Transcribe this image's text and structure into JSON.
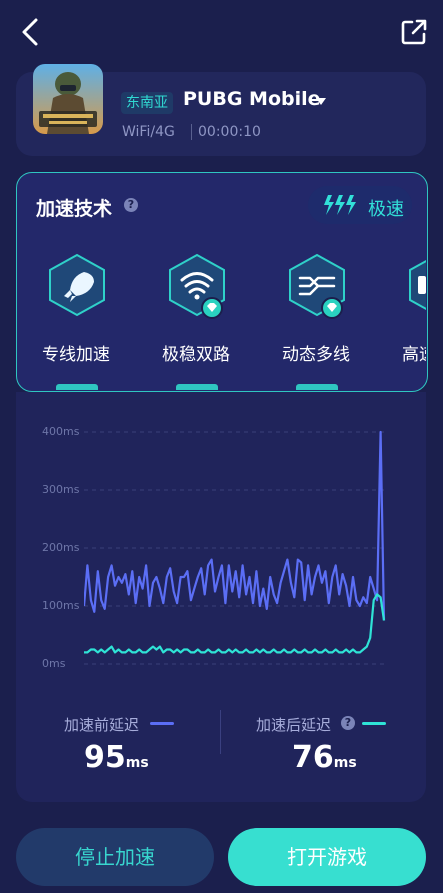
{
  "header": {
    "back_icon": "chevron-left-icon",
    "share_icon": "share-icon"
  },
  "game": {
    "icon": "pubg-game-icon",
    "region": "东南亚",
    "name": "PUBG Mobile",
    "network": "WiFi/4G",
    "timer": "00:00:10"
  },
  "tech": {
    "title": "加速技术",
    "help": "?",
    "mode_label": "极速",
    "features": [
      {
        "label": "专线加速",
        "icon": "rocket-icon",
        "premium": false
      },
      {
        "label": "极稳双路",
        "icon": "wifi-icon",
        "premium": true
      },
      {
        "label": "动态多线",
        "icon": "multiline-icon",
        "premium": true
      },
      {
        "label": "高速",
        "icon": "speed-icon",
        "premium": false
      }
    ]
  },
  "chart_data": {
    "type": "line",
    "yticks": [
      "400ms",
      "300ms",
      "200ms",
      "100ms",
      "0ms"
    ],
    "ylim": [
      0,
      400
    ],
    "grid": true,
    "series": [
      {
        "name": "加速前延迟",
        "color": "#5b6ef5",
        "values": [
          100,
          170,
          110,
          90,
          160,
          110,
          95,
          150,
          170,
          135,
          150,
          140,
          155,
          120,
          160,
          105,
          150,
          130,
          170,
          100,
          140,
          150,
          130,
          105,
          150,
          165,
          125,
          105,
          150,
          150,
          160,
          110,
          130,
          150,
          165,
          120,
          170,
          180,
          125,
          150,
          170,
          105,
          170,
          125,
          160,
          115,
          170,
          120,
          150,
          105,
          160,
          100,
          130,
          95,
          150,
          120,
          105,
          140,
          160,
          180,
          140,
          115,
          180,
          175,
          110,
          170,
          120,
          150,
          170,
          140,
          160,
          105,
          150,
          170,
          120,
          155,
          135,
          100,
          150,
          110,
          100,
          115,
          105,
          150,
          130,
          110,
          400,
          75
        ]
      },
      {
        "name": "加速后延迟",
        "color": "#2fe3d6",
        "values": [
          20,
          20,
          25,
          25,
          20,
          25,
          20,
          25,
          30,
          20,
          25,
          20,
          20,
          25,
          20,
          20,
          25,
          20,
          20,
          25,
          30,
          25,
          30,
          20,
          25,
          25,
          20,
          25,
          20,
          25,
          25,
          20,
          20,
          25,
          20,
          20,
          25,
          20,
          20,
          25,
          20,
          20,
          25,
          20,
          25,
          20,
          20,
          25,
          20,
          20,
          25,
          20,
          25,
          20,
          20,
          25,
          20,
          20,
          25,
          20,
          20,
          25,
          20,
          20,
          25,
          20,
          20,
          25,
          20,
          20,
          25,
          20,
          20,
          25,
          20,
          20,
          25,
          20,
          25,
          20,
          20,
          25,
          30,
          45,
          110,
          120,
          115,
          75
        ]
      }
    ]
  },
  "stats": {
    "before_label": "加速前延迟",
    "before_value": "95",
    "after_label": "加速后延迟",
    "after_help": "?",
    "after_value": "76",
    "unit": "ms"
  },
  "actions": {
    "stop_label": "停止加速",
    "open_label": "打开游戏"
  },
  "colors": {
    "accent": "#37dfd0",
    "background": "#1b1f4d",
    "before_line": "#5b6ef5",
    "after_line": "#2fe3d6"
  }
}
